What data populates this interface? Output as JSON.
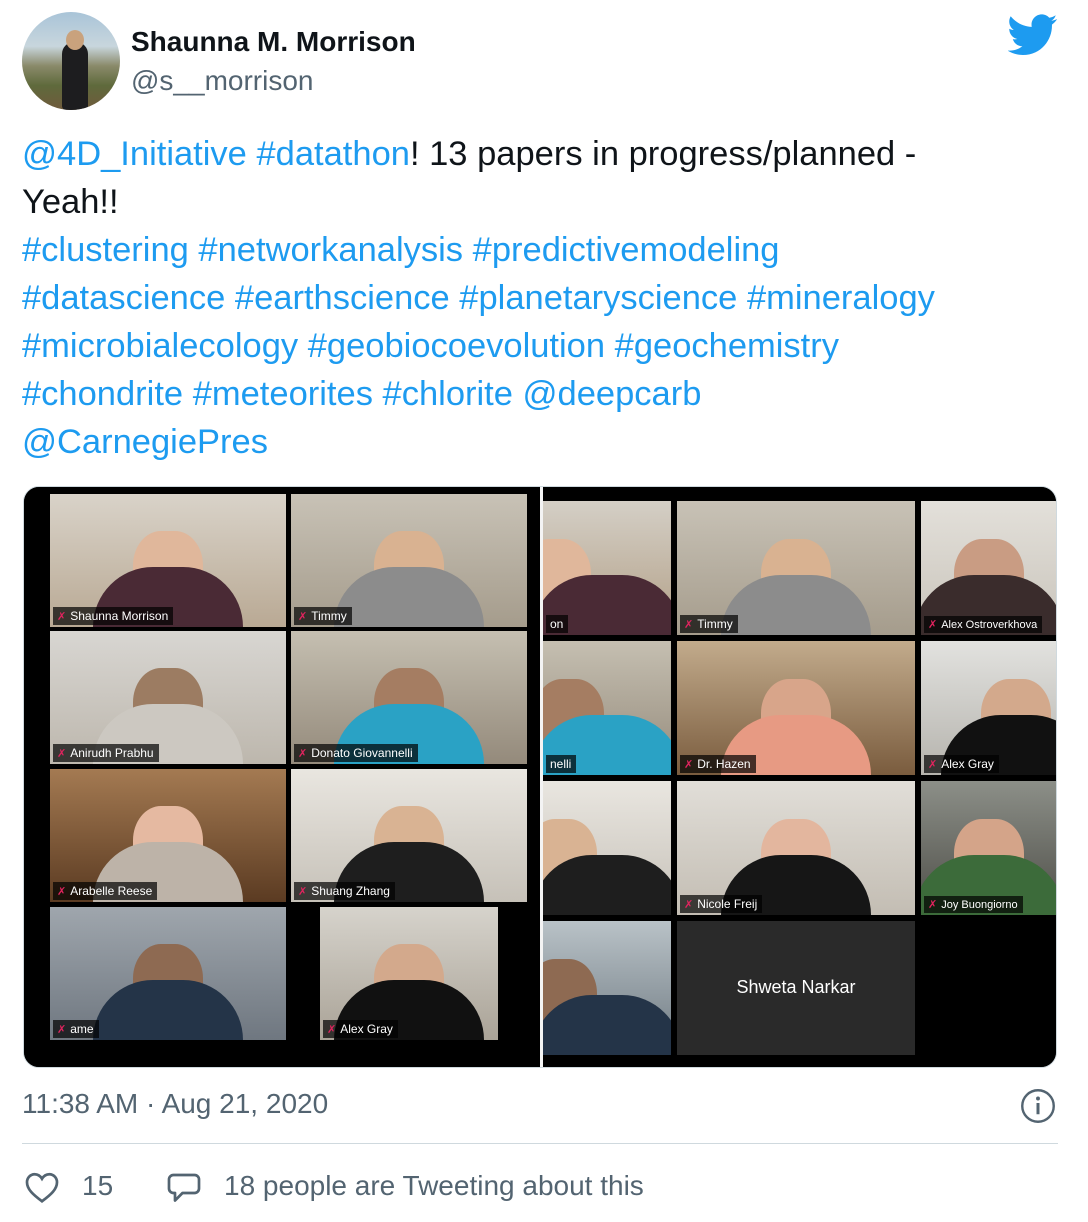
{
  "author": {
    "name": "Shaunna M. Morrison",
    "handle": "@s__morrison"
  },
  "tweet": {
    "line1": {
      "mention": "@4D_Initiative",
      "space": " ",
      "hashtag": "#datathon",
      "rest": "! 13 papers in progress/planned -"
    },
    "line2": "Yeah!!",
    "line3": "#clustering #networkanalysis #predictivemodeling",
    "line4": "#datascience #earthscience #planetaryscience  #mineralogy",
    "line5": "#microbialecology #geobiocoevolution #geochemistry",
    "line6": "#chondrite #meteorites #chlorite @deepcarb",
    "line7": "@CarnegiePres"
  },
  "media": {
    "left_labels": [
      "Shaunna Morrison",
      "Timmy",
      "Anirudh Prabhu",
      "Donato Giovannelli",
      "Arabelle Reese",
      "Shuang Zhang",
      "ame",
      "Alex Gray"
    ],
    "right_labels": [
      "on",
      "Timmy",
      "Alex Ostroverkhova",
      "nelli",
      "Dr. Hazen",
      "Alex Gray",
      "Nicole Freij",
      "Joy Buongiorno",
      "Shweta  Narkar"
    ],
    "mic_glyph": "✗"
  },
  "meta": {
    "timestamp": "11:38 AM · Aug 21, 2020",
    "likes": "15",
    "tweeting": "18 people are Tweeting about this"
  },
  "colors": {
    "link": "#1d9bf0",
    "muted": "#536471",
    "twitter_blue": "#1d9bf0"
  },
  "icons": {
    "bird": "twitter-bird-icon",
    "info": "info-icon",
    "heart": "heart-icon",
    "reply": "reply-icon"
  }
}
